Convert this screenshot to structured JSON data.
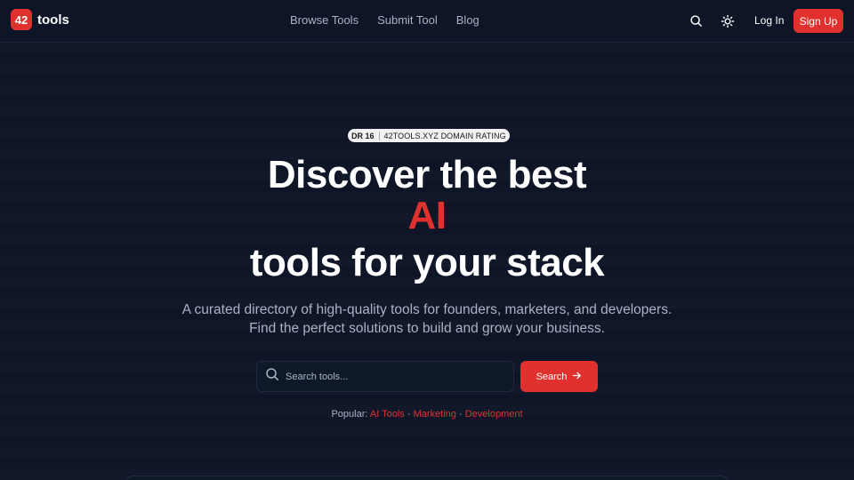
{
  "brand": {
    "badge": "42",
    "name": "tools"
  },
  "nav": {
    "items": [
      "Browse Tools",
      "Submit Tool",
      "Blog"
    ]
  },
  "header": {
    "login": "Log In",
    "signup": "Sign Up",
    "icons": [
      "search-icon",
      "sun-icon"
    ]
  },
  "hero": {
    "badge_dr": "DR 16",
    "badge_text": "42TOOLS.XYZ DOMAIN RATING",
    "title_line1": "Discover the best",
    "title_highlight": "AI",
    "title_line3": "tools for your stack",
    "subtitle": "A curated directory of high-quality tools for founders, marketers, and developers. Find the perfect solutions to build and grow your business."
  },
  "search": {
    "placeholder": "Search tools...",
    "button": "Search"
  },
  "popular": {
    "label": "Popular:",
    "links": [
      "AI Tools",
      "Marketing",
      "Development"
    ],
    "separator": "·"
  },
  "colors": {
    "background": "#0d1527",
    "accent": "#e0312e",
    "muted_text": "#a9b3c4"
  }
}
